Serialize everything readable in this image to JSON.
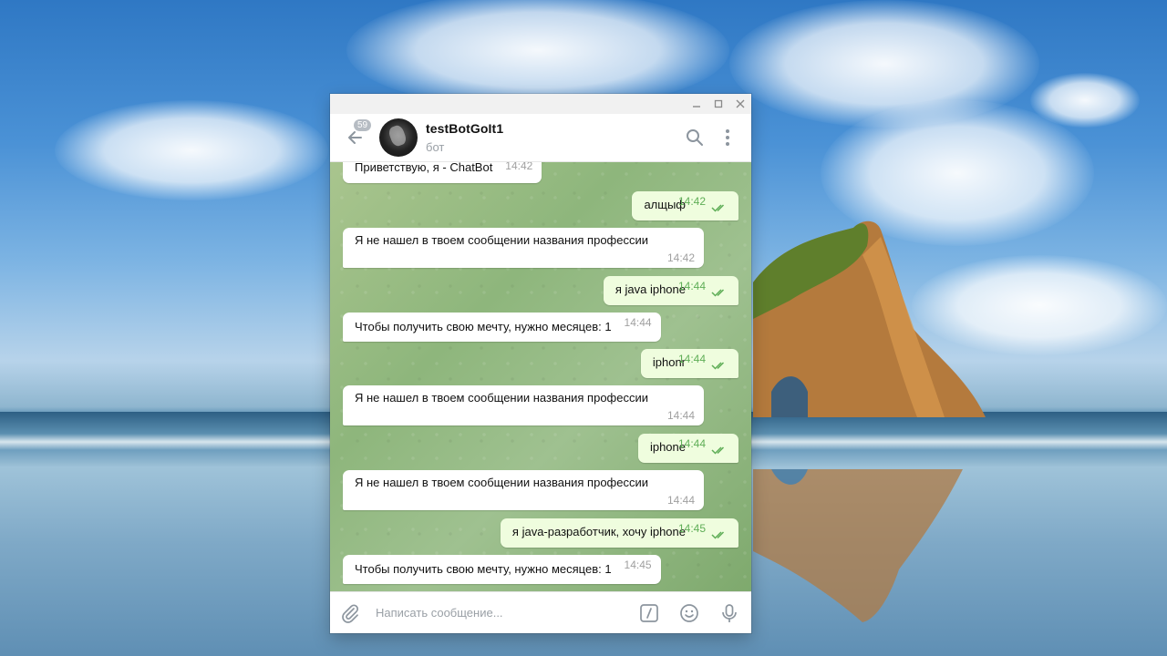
{
  "window": {
    "minimize_icon": "minimize-icon",
    "maximize_icon": "maximize-icon",
    "close_icon": "close-icon"
  },
  "header": {
    "back_badge": "59",
    "title": "testBotGoIt1",
    "subtitle": "бот",
    "search_icon": "search-icon",
    "menu_icon": "more-vertical-icon"
  },
  "messages": [
    {
      "dir": "in",
      "text": "Приветствую, я - ChatBot",
      "time": "14:42",
      "inline": true
    },
    {
      "dir": "out",
      "text": "алщыф",
      "time": "14:42"
    },
    {
      "dir": "in",
      "text": "Я не нашел в твоем сообщении названия профессии",
      "time": "14:42",
      "inline": false
    },
    {
      "dir": "out",
      "text": "я java iphone",
      "time": "14:44"
    },
    {
      "dir": "in",
      "text": "Чтобы получить свою мечту, нужно месяцев: 1",
      "time": "14:44",
      "inline": true
    },
    {
      "dir": "out",
      "text": "iphonr",
      "time": "14:44"
    },
    {
      "dir": "in",
      "text": "Я не нашел в твоем сообщении названия профессии",
      "time": "14:44",
      "inline": false
    },
    {
      "dir": "out",
      "text": "iphone",
      "time": "14:44"
    },
    {
      "dir": "in",
      "text": "Я не нашел в твоем сообщении названия профессии",
      "time": "14:44",
      "inline": false
    },
    {
      "dir": "out",
      "text": "я java-разработчик, хочу iphone",
      "time": "14:45"
    },
    {
      "dir": "in",
      "text": "Чтобы получить свою мечту, нужно месяцев: 1",
      "time": "14:45",
      "inline": true
    }
  ],
  "input": {
    "placeholder": "Написать сообщение..."
  },
  "colors": {
    "outgoing_bubble": "#effdde",
    "incoming_bubble": "#ffffff",
    "check_color": "#5fae57"
  }
}
